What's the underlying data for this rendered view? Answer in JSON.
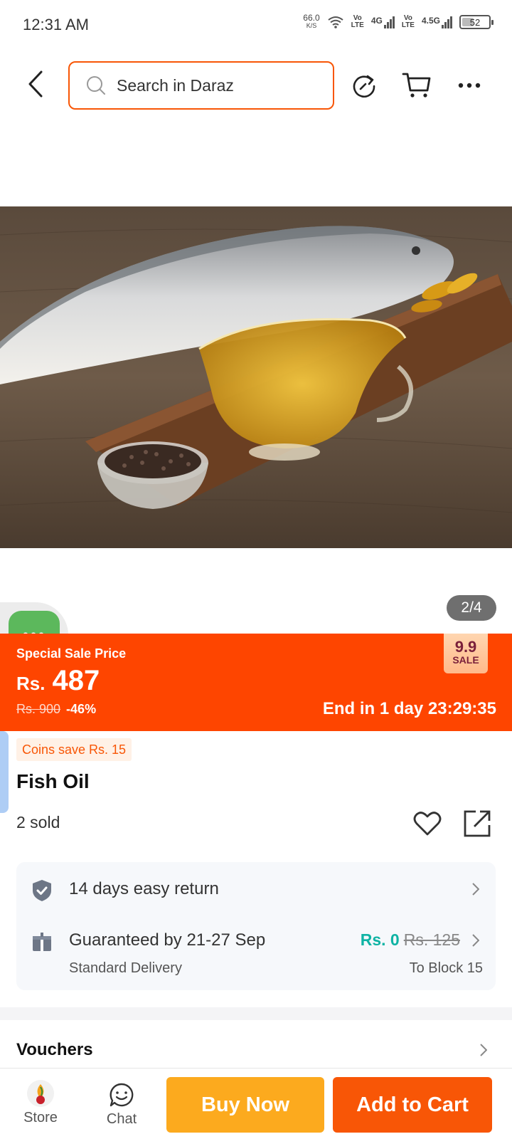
{
  "status_bar": {
    "time": "12:31 AM",
    "net_speed": "66.0",
    "net_unit": "K/S",
    "lte1": "Vo\nLTE",
    "net1": "4G",
    "lte2": "Vo\nLTE",
    "net2": "4.5G",
    "battery": "52"
  },
  "search": {
    "placeholder": "Search in Daraz"
  },
  "gallery": {
    "page_indicator": "2/4",
    "float_chat_label": "•••"
  },
  "sale": {
    "label": "Special Sale Price",
    "currency": "Rs.",
    "price": "487",
    "original_price": "Rs. 900",
    "discount": "-46%",
    "countdown": "End in 1 day 23:29:35",
    "badge_top": "9.9",
    "badge_bottom": "SALE"
  },
  "product": {
    "coins": "Coins save Rs. 15",
    "title": "Fish Oil",
    "sold": "2 sold"
  },
  "service": {
    "returns": "14 days easy return",
    "delivery": "Guaranteed by 21-27 Sep",
    "delivery_type": "Standard Delivery",
    "delivery_fee": "Rs. 0",
    "delivery_fee_old": "Rs. 125",
    "destination": "To Block 15"
  },
  "vouchers": {
    "label": "Vouchers"
  },
  "bottom_bar": {
    "store_label": "Store",
    "chat_label": "Chat",
    "buy_now": "Buy Now",
    "add_to_cart": "Add to Cart"
  },
  "colors": {
    "brand_orange": "#f85606",
    "sale_banner": "#fe4500",
    "buy_now": "#fcaa1e",
    "free_delivery": "#0fb3a4"
  }
}
